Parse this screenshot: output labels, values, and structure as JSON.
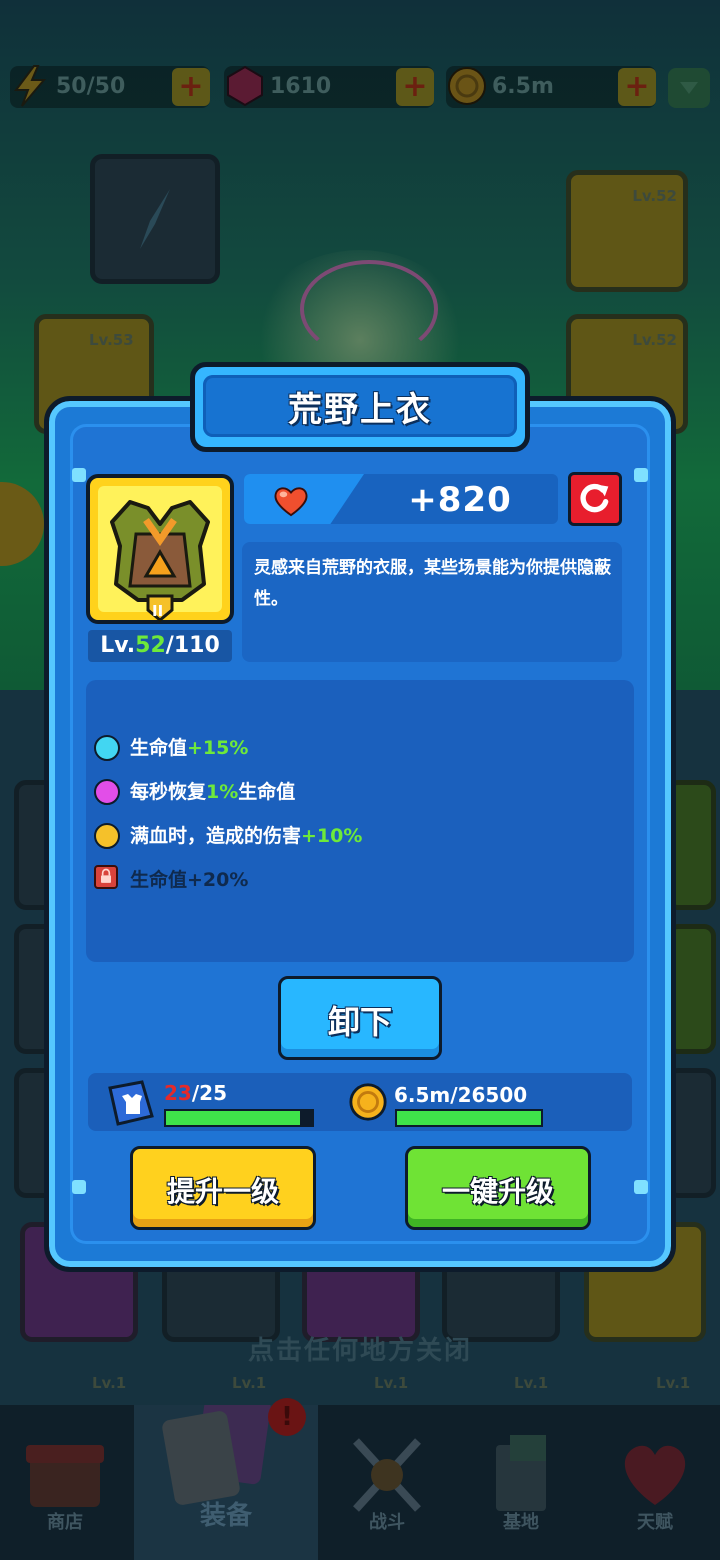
{
  "resources": {
    "energy": "50/50",
    "gems": "1610",
    "coins": "6.5m"
  },
  "background": {
    "slot_levels": [
      "Lv.52",
      "Lv.53",
      "Lv.52",
      "Lv.1",
      "Lv.1",
      "Lv.1",
      "Lv.1",
      "Lv.1"
    ],
    "close_hint": "点击任何地方关闭"
  },
  "nav": {
    "shop": "商店",
    "equipment": "装备",
    "battle": "战斗",
    "base": "基地",
    "talent": "天赋",
    "badge": "!"
  },
  "dialog": {
    "title": "荒野上衣",
    "item": {
      "level_prefix": "Lv.",
      "level_current": "52",
      "level_max": "/110",
      "tier_mark": "II"
    },
    "stat": {
      "value": "+820",
      "icon": "heart-icon"
    },
    "description": "灵感来自荒野的衣服，某些场景能为你提供隐蔽性。",
    "attributes": [
      {
        "dot_color": "#42d6f2",
        "label": "生命值",
        "value": "+15%",
        "suffix": ""
      },
      {
        "dot_color": "#e24ee8",
        "label": "每秒恢复",
        "value": "1%",
        "suffix": "生命值"
      },
      {
        "dot_color": "#f5c12a",
        "label": "满血时，造成的伤害",
        "value": "+10%",
        "suffix": ""
      },
      {
        "locked": true,
        "label": "生命值+20%"
      }
    ],
    "unequip_label": "卸下",
    "materials": {
      "have": "23",
      "need": "/25",
      "progress": 0.92
    },
    "gold": {
      "text": "6.5m/26500",
      "progress": 1.0
    },
    "upgrade_one_label": "提升一级",
    "upgrade_all_label": "一键升级"
  }
}
